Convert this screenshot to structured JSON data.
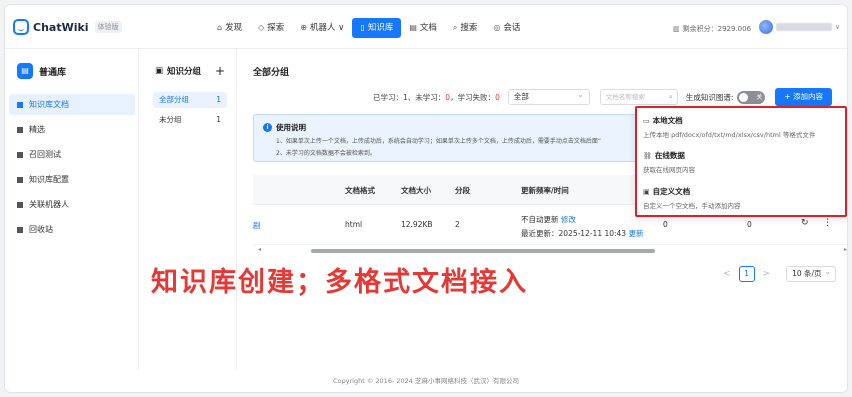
{
  "app": {
    "name": "ChatWiki",
    "badge": "体验版"
  },
  "nav": [
    {
      "icon": "⌂",
      "label": "发现"
    },
    {
      "icon": "◇",
      "label": "探索"
    },
    {
      "icon": "⊕",
      "label": "机器人 ∨"
    },
    {
      "icon": "▯",
      "label": "知识库"
    },
    {
      "icon": "▤",
      "label": "文档"
    },
    {
      "icon": "⌕",
      "label": "搜索"
    },
    {
      "icon": "◎",
      "label": "会话"
    }
  ],
  "header": {
    "credits": "剩余积分：2929.006",
    "credits_icon": "▥"
  },
  "sidebar": {
    "library_title": "普通库",
    "items": [
      {
        "label": "知识库文档"
      },
      {
        "label": "精选"
      },
      {
        "label": "召回测试"
      },
      {
        "label": "知识库配置"
      },
      {
        "label": "关联机器人"
      },
      {
        "label": "回收站"
      }
    ]
  },
  "groups": {
    "title": "知识分组",
    "add": "+",
    "items": [
      {
        "label": "全部分组",
        "count": "1"
      },
      {
        "label": "未分组",
        "count": "1"
      }
    ]
  },
  "main": {
    "title": "全部分组",
    "stats_prefix": "已学习：1、未学习：",
    "unlearned": "0",
    "stats_mid": "，学习失败：",
    "failed": "0",
    "filter_value": "全部",
    "search_placeholder": "文档名称搜索",
    "gen_graph_label": "生成知识图谱:",
    "toggle_text": "关",
    "add_button": "+ 添加内容"
  },
  "notice": {
    "title": "使用说明",
    "line1": "1、如果单次上传一个文档，上传成功后，系统会自动学习；如果单次上传多个文档，上传成功后，需要手动点击文档后面“",
    "line2": "2、未学习的文档数据不会被检索到。"
  },
  "table": {
    "headers": [
      "文档格式",
      "文档大小",
      "分段",
      "更新频率/时间"
    ],
    "row": {
      "name_fragment": "剧",
      "format": "html",
      "size": "12.92KB",
      "segments": "2",
      "freq": "不自动更新",
      "freq_action": "修改",
      "updated": "最近更新：2025-12-11 10:43",
      "update_action": "更新",
      "col5": "0",
      "col6": "0"
    }
  },
  "pagination": {
    "prev": "<",
    "page": "1",
    "next": ">",
    "page_size": "10 条/页"
  },
  "dropdown": [
    {
      "icon": "▭",
      "title": "本地文档",
      "desc": "上传本地 pdf/docx/ofd/txt/md/xlsx/csv/html 等格式文件"
    },
    {
      "icon": "⛓",
      "title": "在线数据",
      "desc": "获取在线网页内容"
    },
    {
      "icon": "▣",
      "title": "自定义文档",
      "desc": "自定义一个空文档，手动添加内容"
    }
  ],
  "caption": "知识库创建；多格式文档接入",
  "footer": "Copyright © 2016- 2024 芝麻小事网络科技（武汉）有限公司"
}
